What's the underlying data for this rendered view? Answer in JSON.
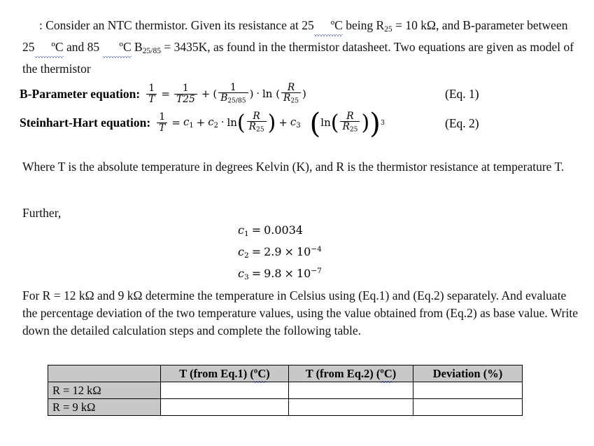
{
  "document": {
    "type": "physics-problem-statement",
    "background_color": "#ffffff",
    "text_color": "#111111"
  },
  "intro": {
    "bullet": ":",
    "line1_a": "Consider an NTC thermistor. Given its resistance at 25",
    "degc_1": "ºC",
    "line1_b": " being R",
    "r25_sub": "25",
    "line1_c": " = 10 kΩ, and B-parameter between 25",
    "degc_2": "ºC",
    "line1_d": " and 85 ",
    "degc_3": "ºC",
    "line1_e": " B",
    "b_sub": "25/85",
    "line1_f": " = 3435K, as found in the thermistor datasheet. Two equations are given as model of the thermistor",
    "full_text": ": Consider an NTC thermistor. Given its resistance at 25ºC being R25 = 10 kΩ, and B-parameter between 25ºC and 85 ºC B25/85 = 3435K, as found in the thermistor datasheet. Two equations are given as model of the thermistor"
  },
  "equations": {
    "eq1": {
      "label": "B-Parameter equation:",
      "number": "(Eq. 1)",
      "latex": "1/T = 1/T25 + (1/B_{25/85}) · ln (R/R_{25})",
      "parts": {
        "lhs_num": "1",
        "lhs_den": "T",
        "equals": "=",
        "t1_num": "1",
        "t1_den": "T25",
        "plus": "+",
        "t2_num": "1",
        "t2_den_base": "B",
        "t2_den_sub": "25/85",
        "dot": "·",
        "ln": "ln",
        "t3_num": "R",
        "t3_den_base": "R",
        "t3_den_sub": "25"
      }
    },
    "eq2": {
      "label": "Steinhart-Hart equation:",
      "number": "(Eq. 2)",
      "latex": "1/T = c_1 + c_2 · ln(R/R_{25}) + c_3 (ln(R/R_{25}))^3",
      "parts": {
        "lhs_num": "1",
        "lhs_den": "T",
        "equals": "=",
        "c1_base": "c",
        "c1_sub": "1",
        "plus1": "+",
        "c2_base": "c",
        "c2_sub": "2",
        "dot": "·",
        "ln": "ln",
        "r_num": "R",
        "r_den_base": "R",
        "r_den_sub": "25",
        "plus2": "+",
        "c3_base": "c",
        "c3_sub": "3",
        "power": "3"
      }
    }
  },
  "where_paragraph": "Where T is the absolute temperature in degrees Kelvin (K), and R is the thermistor resistance at temperature T.",
  "further_label": "Further,",
  "constants": {
    "c1": {
      "symbol": "c",
      "subscript": "1",
      "equals": "=",
      "value": "0.0034",
      "full": "c₁ = 0.0034"
    },
    "c2": {
      "symbol": "c",
      "subscript": "2",
      "equals": "=",
      "mantissa": "2.9",
      "times": "×",
      "base": "10",
      "exponent": "−4",
      "full": "c₂ = 2.9 × 10⁻⁴"
    },
    "c3": {
      "symbol": "c",
      "subscript": "3",
      "equals": "=",
      "mantissa": "9.8",
      "times": "×",
      "base": "10",
      "exponent": "−7",
      "full": "c₃ = 9.8 × 10⁻⁷"
    }
  },
  "task_paragraph": "For R = 12 kΩ and 9 kΩ determine the temperature in Celsius using (Eq.1) and (Eq.2) separately. And evaluate the percentage deviation of the two temperature values, using the value obtained from (Eq.2) as base value. Write down the detailed calculation steps and complete the following table.",
  "table": {
    "header_bg": "#c8c8c8",
    "border_color": "#000000",
    "corner_label": "",
    "columns": [
      {
        "label_plain": "T (from Eq.1) (ºC)",
        "label_main": "T (from Eq.1) (",
        "label_squiggle": "ºC",
        "label_tail": ")"
      },
      {
        "label_plain": "T (from Eq.2) (ºC)",
        "label_main": "T (from Eq.2) (",
        "label_squiggle": "ºC",
        "label_tail": ")"
      },
      {
        "label_plain": "Deviation (%)",
        "label_main": "Deviation (%)",
        "label_squiggle": "",
        "label_tail": ""
      }
    ],
    "rows": [
      {
        "header": "R = 12 kΩ",
        "cells": [
          "",
          "",
          ""
        ]
      },
      {
        "header": "R = 9 kΩ",
        "cells": [
          "",
          "",
          ""
        ]
      }
    ]
  }
}
